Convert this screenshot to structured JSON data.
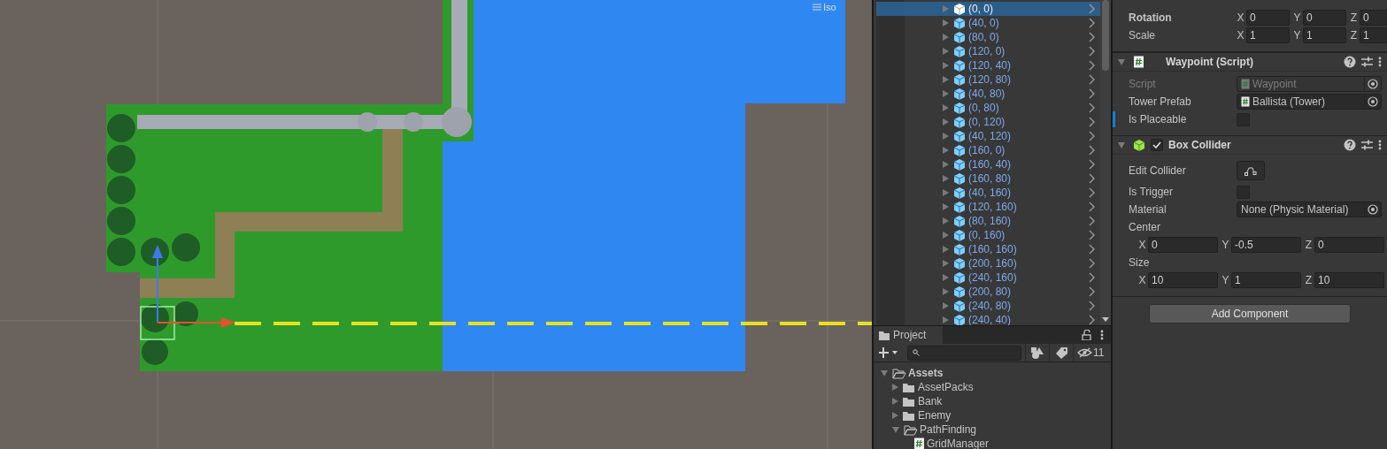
{
  "scene": {
    "view_label": "Iso"
  },
  "hierarchy": {
    "items": [
      {
        "label": "(0, 0)",
        "selected": true,
        "expanded": false
      },
      {
        "label": "(40, 0)",
        "selected": false,
        "expanded": false
      },
      {
        "label": "(80, 0)",
        "selected": false,
        "expanded": false
      },
      {
        "label": "(120, 0)",
        "selected": false,
        "expanded": false
      },
      {
        "label": "(120, 40)",
        "selected": false,
        "expanded": false
      },
      {
        "label": "(120, 80)",
        "selected": false,
        "expanded": false
      },
      {
        "label": "(40, 80)",
        "selected": false,
        "expanded": false
      },
      {
        "label": "(0, 80)",
        "selected": false,
        "expanded": false
      },
      {
        "label": "(0, 120)",
        "selected": false,
        "expanded": false
      },
      {
        "label": "(40, 120)",
        "selected": false,
        "expanded": false
      },
      {
        "label": "(160, 0)",
        "selected": false,
        "expanded": false
      },
      {
        "label": "(160, 40)",
        "selected": false,
        "expanded": false
      },
      {
        "label": "(160, 80)",
        "selected": false,
        "expanded": false
      },
      {
        "label": "(40, 160)",
        "selected": false,
        "expanded": false
      },
      {
        "label": "(120, 160)",
        "selected": false,
        "expanded": false
      },
      {
        "label": "(80, 160)",
        "selected": false,
        "expanded": false
      },
      {
        "label": "(0, 160)",
        "selected": false,
        "expanded": false
      },
      {
        "label": "(160, 160)",
        "selected": false,
        "expanded": false
      },
      {
        "label": "(200, 160)",
        "selected": false,
        "expanded": false
      },
      {
        "label": "(240, 160)",
        "selected": false,
        "expanded": false
      },
      {
        "label": "(200, 80)",
        "selected": false,
        "expanded": false
      },
      {
        "label": "(240, 80)",
        "selected": false,
        "expanded": false
      },
      {
        "label": "(240, 40)",
        "selected": false,
        "expanded": false
      }
    ]
  },
  "project": {
    "tab": "Project",
    "hidden_count": "11",
    "tree": [
      {
        "label": "Assets",
        "kind": "folder",
        "expanded": true,
        "children": [
          {
            "label": "AssetPacks",
            "kind": "folder",
            "expanded": false
          },
          {
            "label": "Bank",
            "kind": "folder",
            "expanded": false
          },
          {
            "label": "Enemy",
            "kind": "folder",
            "expanded": false
          },
          {
            "label": "PathFinding",
            "kind": "folder",
            "expanded": true,
            "children": [
              {
                "label": "GridManager",
                "kind": "script"
              }
            ]
          }
        ]
      }
    ]
  },
  "inspector": {
    "transform_rows": [
      {
        "label": "Rotation",
        "overridden": true,
        "values": [
          {
            "axis": "X",
            "value": "0"
          },
          {
            "axis": "Y",
            "value": "0"
          },
          {
            "axis": "Z",
            "value": "0"
          }
        ]
      },
      {
        "label": "Scale",
        "overridden": false,
        "values": [
          {
            "axis": "X",
            "value": "1"
          },
          {
            "axis": "Y",
            "value": "1"
          },
          {
            "axis": "Z",
            "value": "1"
          }
        ]
      }
    ],
    "components": [
      {
        "title": "Waypoint (Script)",
        "kind": "script",
        "expanded": true,
        "fields": [
          {
            "label": "Script",
            "kind": "object",
            "value": "Waypoint",
            "disabled": true,
            "overridden": false
          },
          {
            "label": "Tower Prefab",
            "kind": "object",
            "value": "Ballista (Tower)",
            "disabled": false,
            "overridden": false
          },
          {
            "label": "Is Placeable",
            "kind": "checkbox",
            "checked": false,
            "disabled": false,
            "overridden": true
          }
        ]
      },
      {
        "title": "Box Collider",
        "kind": "collider",
        "enabled": true,
        "expanded": true,
        "fields": [
          {
            "label": "Edit Collider",
            "kind": "edit",
            "disabled": false,
            "overridden": false
          },
          {
            "label": "Is Trigger",
            "kind": "checkbox",
            "checked": false,
            "disabled": false,
            "overridden": false
          },
          {
            "label": "Material",
            "kind": "object",
            "value": "None (Physic Material)",
            "disabled": false,
            "overridden": false
          },
          {
            "label": "Center",
            "kind": "vector",
            "disabled": false,
            "overridden": false,
            "values": [
              {
                "axis": "X",
                "value": "0"
              },
              {
                "axis": "Y",
                "value": "-0.5"
              },
              {
                "axis": "Z",
                "value": "0"
              }
            ]
          },
          {
            "label": "Size",
            "kind": "vector",
            "disabled": false,
            "overridden": false,
            "values": [
              {
                "axis": "X",
                "value": "10"
              },
              {
                "axis": "Y",
                "value": "1"
              },
              {
                "axis": "Z",
                "value": "10"
              }
            ]
          }
        ]
      }
    ],
    "add_button": "Add Component"
  }
}
